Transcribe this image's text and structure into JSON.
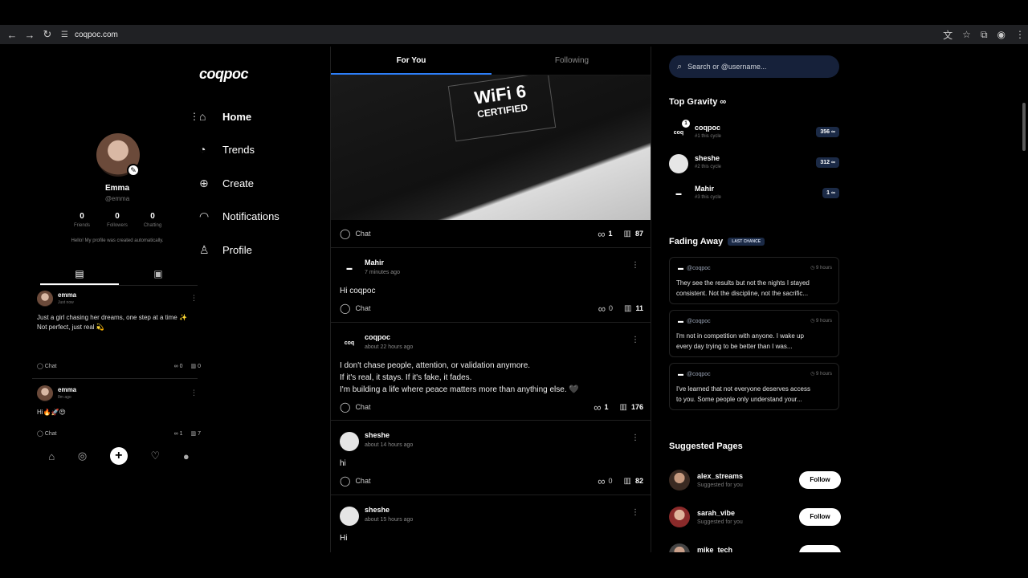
{
  "browser": {
    "url": "coqpoc.com"
  },
  "brand": {
    "logo": "coqpoc"
  },
  "nav": {
    "items": [
      {
        "label": "Home",
        "active": true
      },
      {
        "label": "Trends"
      },
      {
        "label": "Create"
      },
      {
        "label": "Notifications"
      },
      {
        "label": "Profile"
      }
    ]
  },
  "profile": {
    "name": "Emma",
    "handle": "@emma",
    "stats": [
      {
        "value": "0",
        "label": "Friends"
      },
      {
        "value": "0",
        "label": "Followers"
      },
      {
        "value": "0",
        "label": "Chatting"
      }
    ],
    "bio": "Hello! My profile was created automatically.",
    "posts": [
      {
        "name": "emma",
        "time": "Just now",
        "text_line1": "Just a girl chasing her dreams, one step at a time ✨",
        "text_line2": "Not perfect, just real 💫",
        "chat": "Chat",
        "gravity": "0",
        "views": "0"
      },
      {
        "name": "emma",
        "time": "8m ago",
        "text_line1": "Hi🔥🚀😍",
        "text_line2": "",
        "chat": "Chat",
        "gravity": "1",
        "views": "7"
      }
    ]
  },
  "feed": {
    "tabs": {
      "for_you": "For You",
      "following": "Following"
    },
    "image": {
      "line1": "WiFi 6",
      "line2": "CERTIFIED"
    },
    "image_post": {
      "chat": "Chat",
      "gravity": "1",
      "views": "87"
    },
    "posts": [
      {
        "name": "Mahir",
        "time": "7 minutes ago",
        "lines": [
          "Hi coqpoc"
        ],
        "chat": "Chat",
        "gravity": "0",
        "views": "11"
      },
      {
        "name": "coqpoc",
        "time": "about 22 hours ago",
        "lines": [
          "I don't chase people, attention, or validation anymore.",
          "If it's real, it stays. If it's fake, it fades.",
          "I'm building a life where peace matters more than anything else. 🖤"
        ],
        "chat": "Chat",
        "gravity": "1",
        "views": "176"
      },
      {
        "name": "sheshe",
        "time": "about 14 hours ago",
        "lines": [
          "hi"
        ],
        "chat": "Chat",
        "gravity": "0",
        "views": "82"
      },
      {
        "name": "sheshe",
        "time": "about 15 hours ago",
        "lines": [
          "Hi"
        ]
      }
    ]
  },
  "right": {
    "search_placeholder": "Search or @username...",
    "top_gravity": {
      "title": "Top Gravity",
      "items": [
        {
          "name": "coqpoc",
          "sub": "#1 this cycle",
          "score": "356",
          "badge": "1"
        },
        {
          "name": "sheshe",
          "sub": "#2 this cycle",
          "score": "312"
        },
        {
          "name": "Mahir",
          "sub": "#3 this cycle",
          "score": "1"
        }
      ]
    },
    "fading": {
      "title": "Fading Away",
      "badge": "LAST CHANCE",
      "items": [
        {
          "user": "@coqpoc",
          "time": "9 hours",
          "line1": "They see the results but not the nights I stayed",
          "line2": "consistent. Not the discipline, not the sacrific..."
        },
        {
          "user": "@coqpoc",
          "time": "9 hours",
          "line1": "I'm not in competition with anyone. I wake up",
          "line2": "every day trying to be better than I was..."
        },
        {
          "user": "@coqpoc",
          "time": "9 hours",
          "line1": "I've learned that not everyone deserves access",
          "line2": "to you. Some people only understand your..."
        }
      ]
    },
    "suggested": {
      "title": "Suggested Pages",
      "items": [
        {
          "name": "alex_streams",
          "sub": "Suggested for you",
          "button": "Follow"
        },
        {
          "name": "sarah_vibe",
          "sub": "Suggested for you",
          "button": "Follow"
        },
        {
          "name": "mike_tech"
        }
      ]
    }
  }
}
